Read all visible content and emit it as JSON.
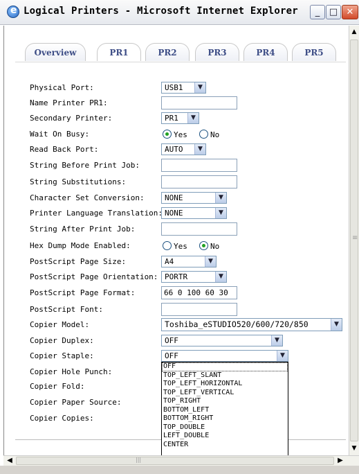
{
  "window": {
    "title": "Logical Printers - Microsoft Internet Explorer",
    "buttons": {
      "minimize": "_",
      "maximize": "□",
      "close": "✕"
    }
  },
  "tabs": [
    {
      "label": "Overview",
      "active": false
    },
    {
      "label": "PR1",
      "active": true
    },
    {
      "label": "PR2",
      "active": false
    },
    {
      "label": "PR3",
      "active": false
    },
    {
      "label": "PR4",
      "active": false
    },
    {
      "label": "PR5",
      "active": false
    }
  ],
  "form": {
    "physical_port": {
      "label": "Physical Port:",
      "value": "USB1"
    },
    "name_printer": {
      "label": "Name Printer PR1:",
      "value": ""
    },
    "secondary_printer": {
      "label": "Secondary Printer:",
      "value": "PR1"
    },
    "wait_on_busy": {
      "label": "Wait On Busy:",
      "options": [
        "Yes",
        "No"
      ],
      "selected": "Yes"
    },
    "read_back_port": {
      "label": "Read Back Port:",
      "value": "AUTO"
    },
    "string_before": {
      "label": "String Before Print Job:",
      "value": ""
    },
    "string_subst": {
      "label": "String Substitutions:",
      "value": ""
    },
    "charset_conv": {
      "label": "Character Set Conversion:",
      "value": "NONE"
    },
    "lang_translation": {
      "label": "Printer Language Translation:",
      "value": "NONE"
    },
    "string_after": {
      "label": "String After Print Job:",
      "value": ""
    },
    "hex_dump": {
      "label": "Hex Dump Mode Enabled:",
      "options": [
        "Yes",
        "No"
      ],
      "selected": "No"
    },
    "ps_page_size": {
      "label": "PostScript Page Size:",
      "value": "A4"
    },
    "ps_orientation": {
      "label": "PostScript Page Orientation:",
      "value": "PORTR"
    },
    "ps_format": {
      "label": "PostScript Page Format:",
      "value": "66 0 100 60 30"
    },
    "ps_font": {
      "label": "PostScript Font:",
      "value": ""
    },
    "copier_model": {
      "label": "Copier Model:",
      "value": "Toshiba_eSTUDIO520/600/720/850"
    },
    "copier_duplex": {
      "label": "Copier Duplex:",
      "value": "OFF"
    },
    "copier_staple": {
      "label": "Copier Staple:",
      "value": "OFF"
    },
    "copier_hole_punch": {
      "label": "Copier Hole Punch:"
    },
    "copier_fold": {
      "label": "Copier Fold:"
    },
    "copier_paper_source": {
      "label": "Copier Paper Source:"
    },
    "copier_copies": {
      "label": "Copier Copies:"
    }
  },
  "staple_dropdown": {
    "options": [
      "OFF",
      "TOP_LEFT_SLANT",
      "TOP_LEFT_HORIZONTAL",
      "TOP_LEFT_VERTICAL",
      "TOP_RIGHT",
      "BOTTOM_LEFT",
      "BOTTOM_RIGHT",
      "TOP_DOUBLE",
      "LEFT_DOUBLE",
      "CENTER"
    ],
    "highlighted": "OFF"
  },
  "icons": {
    "dropdown": "▼",
    "scroll_up": "▲",
    "scroll_down": "▼",
    "scroll_left": "◀",
    "scroll_right": "▶"
  }
}
